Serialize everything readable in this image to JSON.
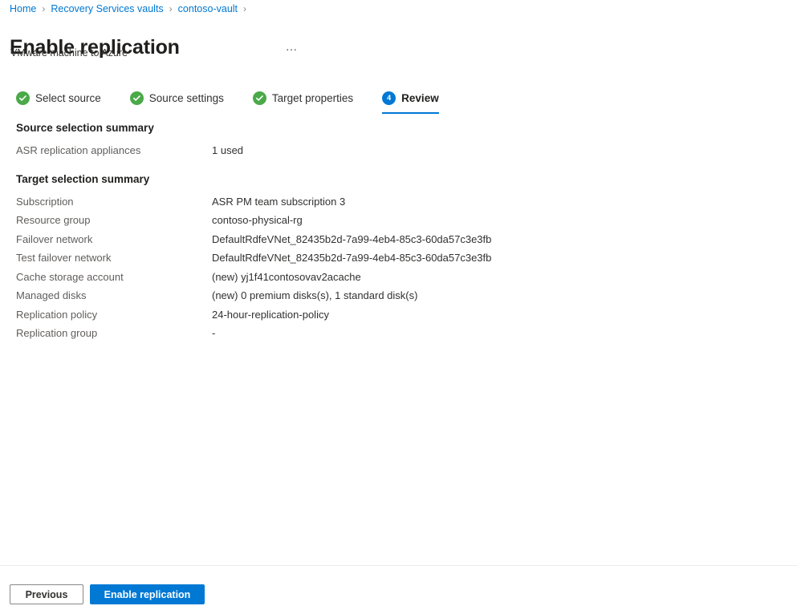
{
  "breadcrumb": {
    "items": [
      {
        "label": "Home"
      },
      {
        "label": "Recovery Services vaults"
      },
      {
        "label": "contoso-vault"
      }
    ],
    "separator": "›"
  },
  "header": {
    "title": "Enable replication",
    "subtitle": "VMware machine to Azure",
    "more_label": "…"
  },
  "steps": [
    {
      "label": "Select source",
      "state": "done",
      "number": "1"
    },
    {
      "label": "Source settings",
      "state": "done",
      "number": "2"
    },
    {
      "label": "Target properties",
      "state": "done",
      "number": "3"
    },
    {
      "label": "Review",
      "state": "active",
      "number": "4"
    }
  ],
  "source_summary": {
    "heading": "Source selection summary",
    "rows": [
      {
        "label": "ASR replication appliances",
        "value": "1 used"
      }
    ]
  },
  "target_summary": {
    "heading": "Target selection summary",
    "rows": [
      {
        "label": "Subscription",
        "value": "ASR PM team subscription 3"
      },
      {
        "label": "Resource group",
        "value": "contoso-physical-rg"
      },
      {
        "label": "Failover network",
        "value": "DefaultRdfeVNet_82435b2d-7a99-4eb4-85c3-60da57c3e3fb"
      },
      {
        "label": "Test failover network",
        "value": "DefaultRdfeVNet_82435b2d-7a99-4eb4-85c3-60da57c3e3fb"
      },
      {
        "label": "Cache storage account",
        "value": "(new) yj1f41contosovav2acache"
      },
      {
        "label": "Managed disks",
        "value": "(new) 0 premium disks(s), 1 standard disk(s)"
      },
      {
        "label": "Replication policy",
        "value": "24-hour-replication-policy"
      },
      {
        "label": "Replication group",
        "value": "-"
      }
    ]
  },
  "footer": {
    "previous_label": "Previous",
    "submit_label": "Enable replication"
  },
  "colors": {
    "accent": "#0078d4",
    "success": "#4aa948",
    "link": "#0078d4",
    "label_text": "#605e5c",
    "value_text": "#323130"
  }
}
